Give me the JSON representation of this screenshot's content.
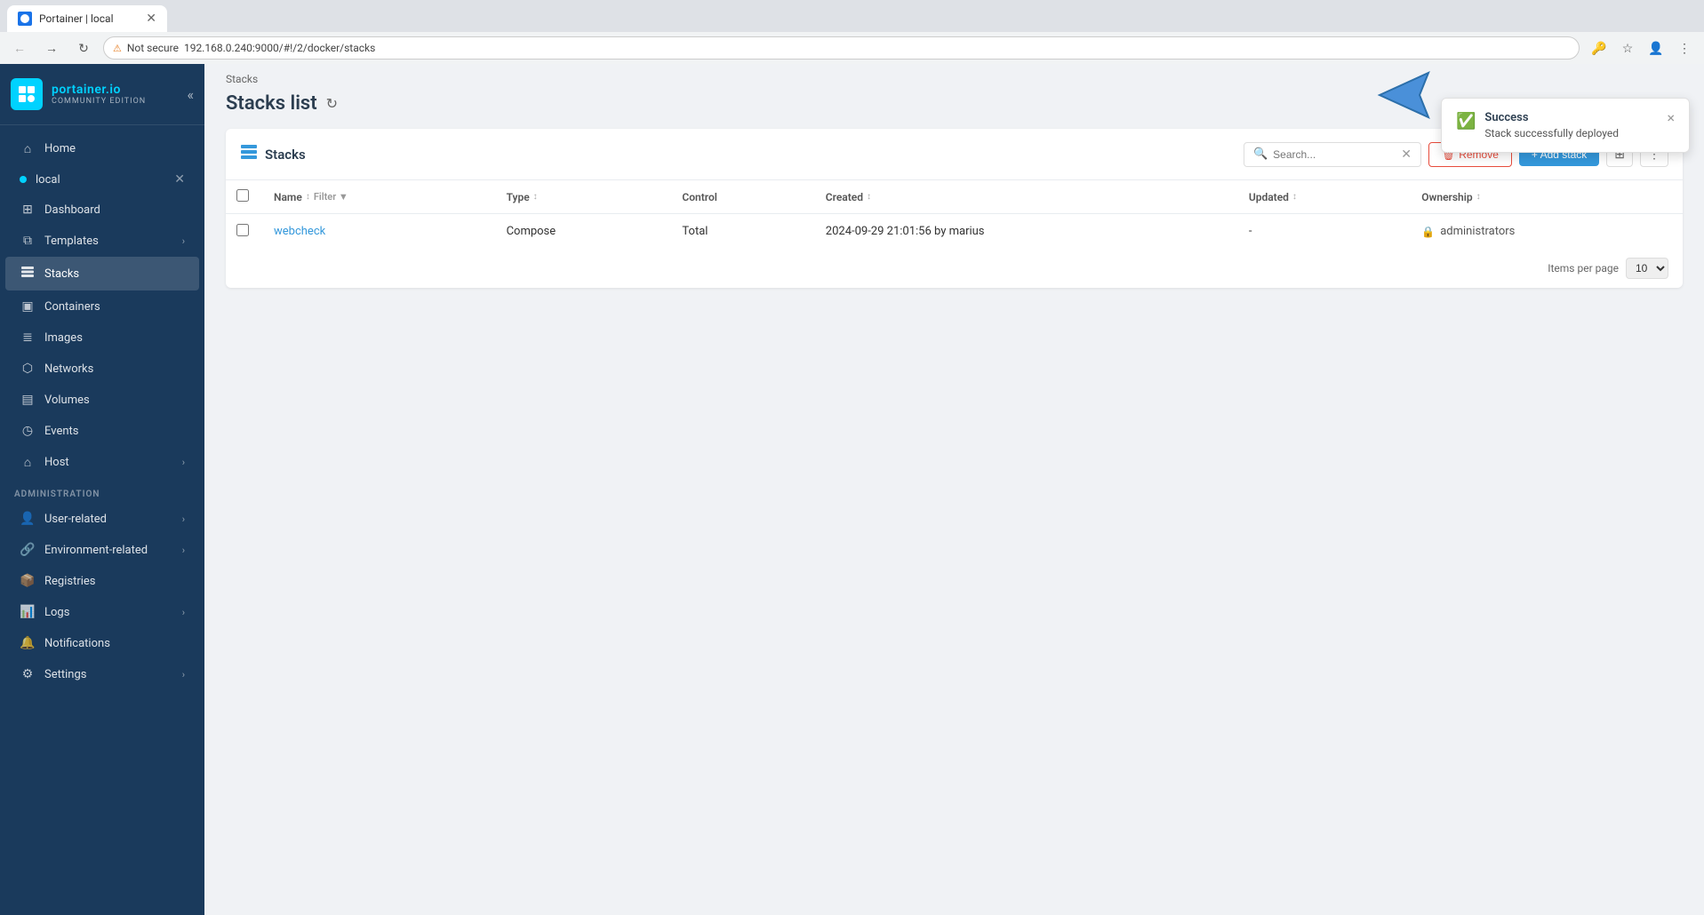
{
  "browser": {
    "tab_title": "Portainer | local",
    "url": "192.168.0.240:9000/#!/2/docker/stacks",
    "not_secure_label": "Not secure"
  },
  "sidebar": {
    "logo_main": "portainer.io",
    "logo_sub": "Community Edition",
    "home_label": "Home",
    "environment_label": "local",
    "nav_items": [
      {
        "id": "dashboard",
        "label": "Dashboard",
        "icon": "⊞"
      },
      {
        "id": "templates",
        "label": "Templates",
        "icon": "⧉",
        "has_chevron": true
      },
      {
        "id": "stacks",
        "label": "Stacks",
        "icon": "≡",
        "active": true
      },
      {
        "id": "containers",
        "label": "Containers",
        "icon": "▣"
      },
      {
        "id": "images",
        "label": "Images",
        "icon": "≣"
      },
      {
        "id": "networks",
        "label": "Networks",
        "icon": "⬡"
      },
      {
        "id": "volumes",
        "label": "Volumes",
        "icon": "▤"
      },
      {
        "id": "events",
        "label": "Events",
        "icon": "◷"
      },
      {
        "id": "host",
        "label": "Host",
        "icon": "⌂",
        "has_chevron": true
      }
    ],
    "admin_section": "Administration",
    "admin_items": [
      {
        "id": "user-related",
        "label": "User-related",
        "icon": "👤",
        "has_chevron": true
      },
      {
        "id": "environment-related",
        "label": "Environment-related",
        "icon": "🔗",
        "has_chevron": true
      },
      {
        "id": "registries",
        "label": "Registries",
        "icon": "📦"
      },
      {
        "id": "logs",
        "label": "Logs",
        "icon": "📊",
        "has_chevron": true
      },
      {
        "id": "notifications",
        "label": "Notifications",
        "icon": "🔔"
      },
      {
        "id": "settings",
        "label": "Settings",
        "icon": "⚙",
        "has_chevron": true
      }
    ]
  },
  "page": {
    "breadcrumb": "Stacks",
    "title": "Stacks list"
  },
  "panel": {
    "title": "Stacks",
    "search_placeholder": "Search...",
    "remove_label": "Remove",
    "add_label": "+ Add stack",
    "table": {
      "columns": [
        "Name",
        "Filter",
        "Type",
        "Control",
        "Created",
        "Updated",
        "Ownership"
      ],
      "rows": [
        {
          "name": "webcheck",
          "type": "Compose",
          "control": "Total",
          "created": "2024-09-29 21:01:56 by marius",
          "updated": "-",
          "ownership": "administrators"
        }
      ]
    },
    "items_per_page_label": "Items per page",
    "items_per_page_value": "10"
  },
  "toast": {
    "title": "Success",
    "message": "Stack successfully deployed",
    "close_label": "×"
  }
}
